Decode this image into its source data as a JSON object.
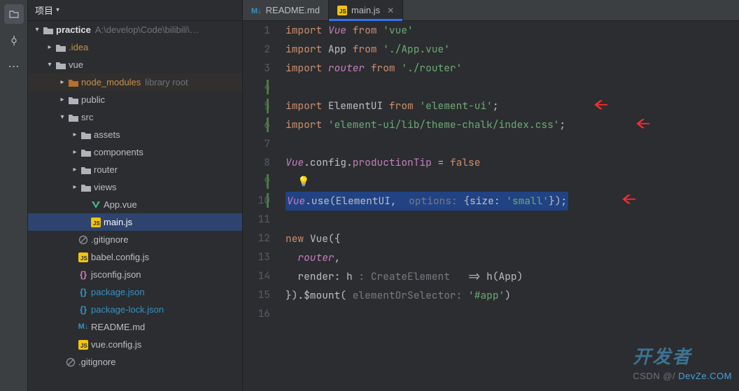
{
  "panel": {
    "title": "项目"
  },
  "tree": {
    "root": {
      "name": "practice",
      "path": "A:\\develop\\Code\\bilibili\\…"
    },
    "items": {
      "idea": ".idea",
      "vue": "vue",
      "node_modules": "node_modules",
      "node_modules_hint": "library root",
      "public": "public",
      "src": "src",
      "assets": "assets",
      "components": "components",
      "router": "router",
      "views": "views",
      "app_vue": "App.vue",
      "main_js": "main.js",
      "gitignore1": ".gitignore",
      "babel": "babel.config.js",
      "jsconfig": "jsconfig.json",
      "pkg": "package.json",
      "pkglock": "package-lock.json",
      "readme": "README.md",
      "vuecfg": "vue.config.js",
      "gitignore2": ".gitignore"
    }
  },
  "tabs": {
    "readme": "README.md",
    "mainjs": "main.js"
  },
  "code": {
    "l1": {
      "kw1": "import",
      "sym": "Vue",
      "kw2": "from",
      "str": "'vue'"
    },
    "l2": {
      "kw1": "import",
      "sym": "App",
      "kw2": "from",
      "str": "'./App.vue'"
    },
    "l3": {
      "kw1": "import",
      "sym": "router",
      "kw2": "from",
      "str": "'./router'"
    },
    "l5": {
      "kw1": "import",
      "sym": "ElementUI",
      "kw2": "from",
      "str": "'element-ui'"
    },
    "l6": {
      "kw1": "import",
      "str": "'element-ui/lib/theme-chalk/index.css'"
    },
    "l8": {
      "a": "Vue",
      "b": ".config.",
      "c": "productionTip",
      "d": " = ",
      "e": "false"
    },
    "l10": {
      "a": "Vue",
      "b": ".use(ElementUI,",
      "hint": "options:",
      "c": "{size: ",
      "str": "'small'",
      "d": "});"
    },
    "l12": {
      "kw": "new",
      "cls": "Vue",
      "open": "({"
    },
    "l13": {
      "a": "router",
      "b": ","
    },
    "l14": {
      "a": "render: h",
      "hint": ": CreateElement",
      "b": " => h(App)"
    },
    "l15": {
      "a": "}).$mount(",
      "hint": "elementOrSelector:",
      "str": "'#app'",
      "b": ")"
    }
  },
  "watermark": {
    "csdn": "CSDN @/",
    "brand": "开发者",
    "domain": "DevZe.COM"
  }
}
